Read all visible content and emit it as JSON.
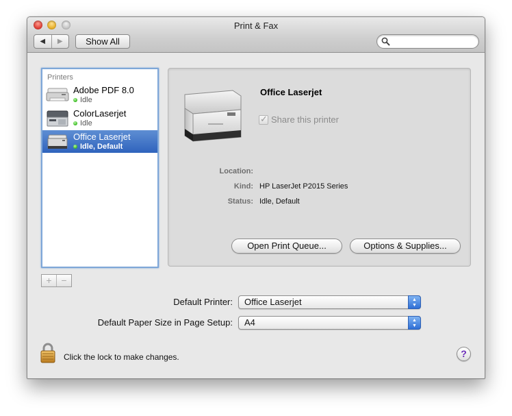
{
  "window": {
    "title": "Print & Fax"
  },
  "toolbar": {
    "back_icon": "back-arrow-icon",
    "forward_icon": "forward-arrow-icon",
    "show_all_label": "Show All",
    "search_placeholder": "",
    "search_icon": "magnifier-icon"
  },
  "printers": {
    "header": "Printers",
    "items": [
      {
        "name": "Adobe PDF 8.0",
        "status": "Idle",
        "icon": "pdf-printer-icon"
      },
      {
        "name": "ColorLaserjet",
        "status": "Idle",
        "icon": "color-printer-icon"
      },
      {
        "name": "Office Laserjet",
        "status": "Idle, Default",
        "icon": "laser-printer-icon"
      }
    ],
    "selected_index": 2,
    "add_label": "+",
    "remove_label": "−"
  },
  "detail": {
    "name": "Office Laserjet",
    "share_label": "Share this printer",
    "share_checked": true,
    "location_label": "Location:",
    "location_value": "",
    "kind_label": "Kind:",
    "kind_value": "HP LaserJet P2015 Series",
    "status_label": "Status:",
    "status_value": "Idle, Default",
    "open_queue_label": "Open Print Queue...",
    "options_label": "Options & Supplies..."
  },
  "settings": {
    "default_printer_label": "Default Printer:",
    "default_printer_value": "Office Laserjet",
    "paper_size_label": "Default Paper Size in Page Setup:",
    "paper_size_value": "A4"
  },
  "footer": {
    "lock_text": "Click the lock to make changes.",
    "help_label": "?"
  }
}
